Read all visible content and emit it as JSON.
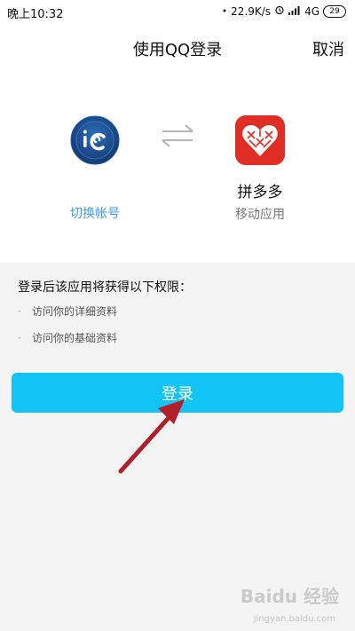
{
  "status_bar": {
    "time": "晚上10:32",
    "network_speed": "22.9K/s",
    "network_type": "4G",
    "battery": "29",
    "icons": [
      "signal-dots-icon",
      "alarm-icon",
      "signal-bars-icon"
    ]
  },
  "header": {
    "title": "使用QQ登录",
    "cancel_label": "取消"
  },
  "account": {
    "switch_label": "切换帐号",
    "avatar_icon": "user-avatar-icon"
  },
  "app": {
    "name": "拼多多",
    "type": "移动应用",
    "icon": "pinduoduo-icon",
    "brand_color": "#e02e24"
  },
  "swap_icon": "swap-arrows-icon",
  "permissions": {
    "title": "登录后该应用将获得以下权限：",
    "items": [
      "访问你的详细资料",
      "访问你的基础资料"
    ]
  },
  "login_button": {
    "label": "登录",
    "color": "#12c3f5"
  },
  "annotation": {
    "arrow_color": "#b0202a"
  },
  "watermark": {
    "text": "Baidu 经验",
    "sub": "jingyan.baidu.com"
  }
}
